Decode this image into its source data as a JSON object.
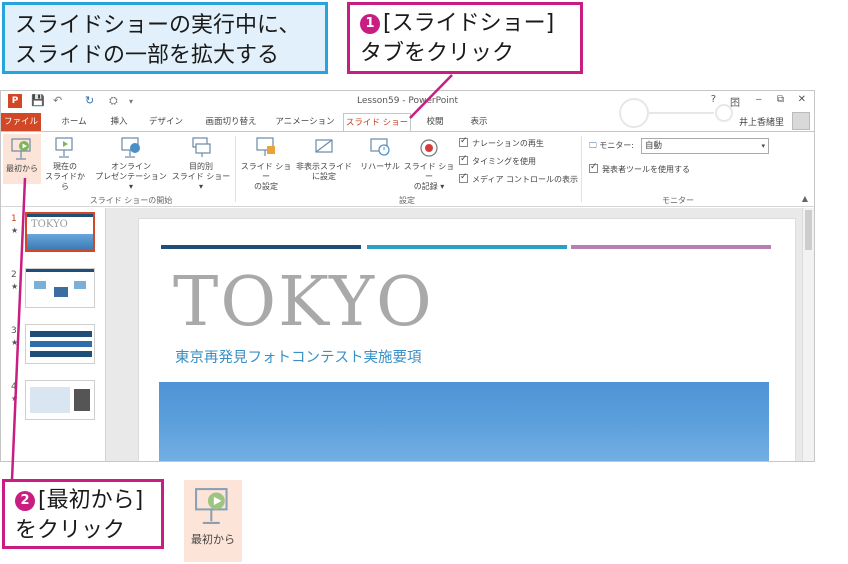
{
  "callouts": {
    "intro": {
      "line1": "スライドショーの実行中に、",
      "line2": "スライドの一部を拡大する"
    },
    "step1": {
      "number": "❶",
      "line1": "[スライドショー]",
      "line2": "タブをクリック"
    },
    "step2": {
      "number": "❷",
      "line1": "[最初から]",
      "line2": "をクリック"
    }
  },
  "window": {
    "title": "Lesson59 - PowerPoint",
    "logo": "P",
    "controls": {
      "help": "?",
      "ribbon_opts": "囨",
      "minimize": "‒",
      "restore": "⧉",
      "close": "✕"
    },
    "user": "井上香緒里"
  },
  "tabs": [
    {
      "label": "ファイル",
      "key": "file"
    },
    {
      "label": "ホーム",
      "key": "home"
    },
    {
      "label": "挿入",
      "key": "insert"
    },
    {
      "label": "デザイン",
      "key": "design"
    },
    {
      "label": "画面切り替え",
      "key": "transitions"
    },
    {
      "label": "アニメーション",
      "key": "animations"
    },
    {
      "label": "スライド ショー",
      "key": "slideshow"
    },
    {
      "label": "校閲",
      "key": "review"
    },
    {
      "label": "表示",
      "key": "view"
    }
  ],
  "ribbon": {
    "start_group": {
      "label": "スライド ショーの開始",
      "from_beginning": "最初から",
      "from_current_1": "現在の",
      "from_current_2": "スライドから",
      "online_1": "オンライン",
      "online_2": "プレゼンテーション ▾",
      "custom_1": "目的別",
      "custom_2": "スライド ショー ▾"
    },
    "setup_group": {
      "label": "設定",
      "setup_1": "スライド ショー",
      "setup_2": "の設定",
      "hide_1": "非表示スライド",
      "hide_2": "に設定",
      "rehearse": "リハーサル",
      "record_1": "スライド ショー",
      "record_2": "の記録 ▾",
      "narration": "ナレーションの再生",
      "timings": "タイミングを使用",
      "media": "メディア コントロールの表示"
    },
    "monitor_group": {
      "label": "モニター",
      "monitor_label": "モニター:",
      "monitor_value": "自動",
      "presenter_view": "発表者ツールを使用する"
    }
  },
  "thumbnails": [
    {
      "number": "1",
      "star": "★",
      "title": "TOKYO"
    },
    {
      "number": "2",
      "star": "★"
    },
    {
      "number": "3",
      "star": "★"
    },
    {
      "number": "4",
      "star": "★"
    }
  ],
  "slide": {
    "title": "TOKYO",
    "subtitle": "東京再発見フォトコンテスト実施要項"
  },
  "enlarged_button": {
    "label": "最初から"
  },
  "colors": {
    "accent_pink": "#c81e82",
    "accent_blue": "#29a3dc",
    "ppt_orange": "#d24726",
    "bar_dark": "#1f4e79",
    "bar_teal": "#2aa0c2",
    "bar_purple": "#b57fb4"
  }
}
